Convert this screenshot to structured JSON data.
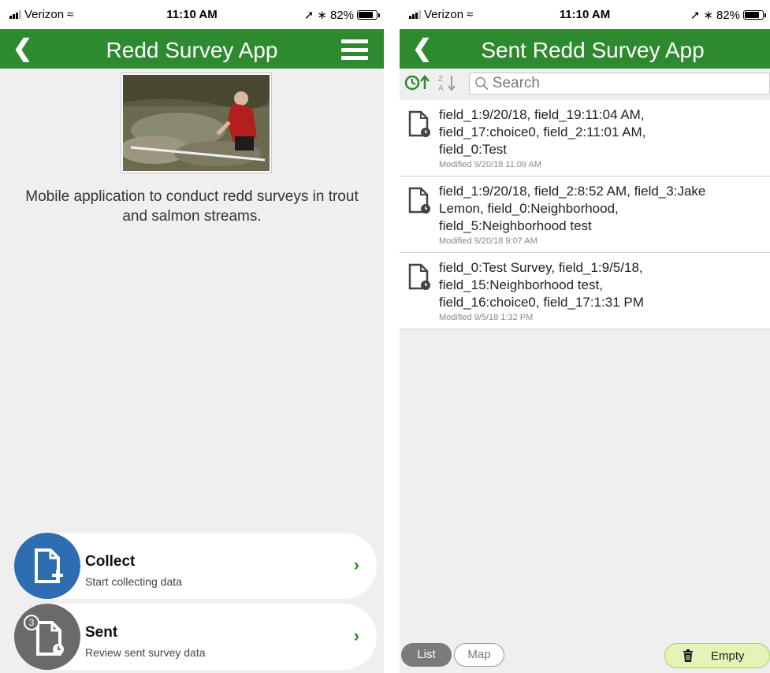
{
  "status_left": {
    "carrier": "Verizon",
    "time": "11:10 AM",
    "battery": "82%",
    "battery_level": 0.82
  },
  "status_right": {
    "carrier": "Verizon",
    "time": "11:10 AM",
    "battery": "82%",
    "battery_level": 0.82
  },
  "home": {
    "title": "Redd Survey App",
    "description": "Mobile application to conduct redd surveys in trout and salmon streams.",
    "collect": {
      "label": "Collect",
      "sub": "Start collecting data"
    },
    "sent": {
      "label": "Sent",
      "sub": "Review sent survey data",
      "badge": "3"
    }
  },
  "sent_screen": {
    "title": "Sent Redd Survey App",
    "search_placeholder": "Search",
    "items": [
      {
        "lines": [
          "field_1:9/20/18, field_19:11:04 AM,",
          "field_17:choice0, field_2:11:01 AM,",
          "field_0:Test"
        ],
        "modified": "Modified 9/20/18 11:09 AM"
      },
      {
        "lines": [
          "field_1:9/20/18, field_2:8:52 AM, field_3:Jake",
          "Lemon, field_0:Neighborhood,",
          "field_5:Neighborhood test"
        ],
        "modified": "Modified 9/20/18 9:07 AM"
      },
      {
        "lines": [
          "field_0:Test Survey, field_1:9/5/18,",
          "field_15:Neighborhood test,",
          "field_16:choice0, field_17:1:31 PM"
        ],
        "modified": "Modified 9/5/18 1:32 PM"
      }
    ],
    "tabs": {
      "list": "List",
      "map": "Map"
    },
    "empty_label": "Empty"
  },
  "colors": {
    "accent": "#2e8a2e",
    "collect_circle": "#2f6db3",
    "sent_circle": "#6a6a6a",
    "empty_button": "#e4f3b8"
  }
}
